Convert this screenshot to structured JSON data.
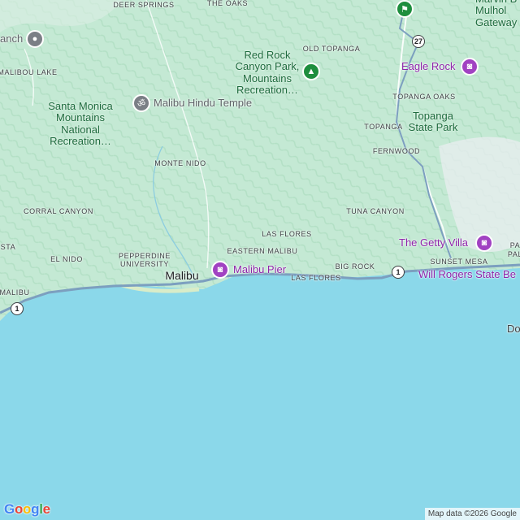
{
  "places": {
    "deer_springs": "DEER SPRINGS",
    "the_oaks": "THE OAKS",
    "old_topanga": "OLD TOPANGA",
    "malibou_lake": "MALIBOU LAKE",
    "topanga_oaks": "TOPANGA OAKS",
    "topanga": "TOPANGA",
    "fernwood": "FERNWOOD",
    "monte_nido": "MONTE NIDO",
    "corral_canyon": "CORRAL CANYON",
    "tuna_canyon": "TUNA CANYON",
    "las_flores_north": "LAS FLORES",
    "eastern_malibu": "EASTERN MALIBU",
    "el_nido": "EL NIDO",
    "pepperdine": "PEPPERDINE\nUNIVERSITY",
    "big_rock": "BIG ROCK",
    "las_flores_south": "LAS FLORES",
    "sunset_mesa": "SUNSET MESA",
    "malibu_west": "MALIBU",
    "sta": "STA",
    "pa": "PA",
    "pal": "PAL"
  },
  "parks": {
    "red_rock": "Red Rock\nCanyon Park,\nMountains\nRecreation…",
    "santa_monica_mtns": "Santa Monica\nMountains\nNational\nRecreation…",
    "topanga_state_park": "Topanga\nState Park",
    "marvin_braude": "Marvin B\nMulhol\nGateway"
  },
  "city": {
    "malibu": "Malibu"
  },
  "pois": {
    "malibu_hindu_temple": "Malibu Hindu Temple",
    "eagle_rock": "Eagle Rock",
    "getty_villa": "The Getty Villa",
    "malibu_pier": "Malibu Pier",
    "will_rogers": "Will Rogers State Be",
    "ranch": "anch",
    "do": "Do"
  },
  "routes": {
    "pch_a": "1",
    "pch_b": "1",
    "topanga_canyon": "27"
  },
  "attribution": "Map data ©2026 Google",
  "logo": "Google",
  "colors": {
    "terrain": "#cfeede",
    "ocean": "#8bd8ea",
    "poi_purple": "#a142c2",
    "park_green": "#1e8e3e",
    "road": "#ffffff",
    "highway_blue": "#7c9fbf"
  },
  "icons": {
    "temple": "om-icon",
    "camera": "camera-icon",
    "tree": "tree-icon",
    "hiker": "hiking-icon",
    "pin": "place-icon"
  }
}
